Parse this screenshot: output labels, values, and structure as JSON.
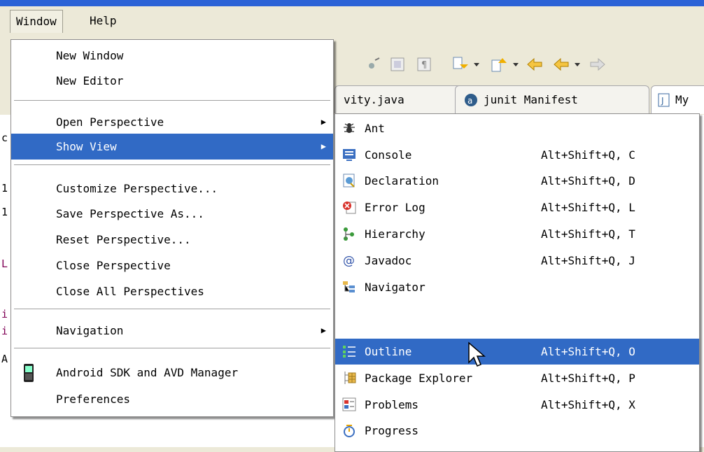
{
  "menubar": {
    "window": "Window",
    "help": "Help"
  },
  "tabs": [
    {
      "label": "vity.java"
    },
    {
      "label": "junit Manifest"
    },
    {
      "label": "My"
    }
  ],
  "window_menu": {
    "new_window": "New Window",
    "new_editor": "New Editor",
    "open_perspective": "Open Perspective",
    "show_view": "Show View",
    "customize_perspective": "Customize Perspective...",
    "save_perspective_as": "Save Perspective As...",
    "reset_perspective": "Reset Perspective...",
    "close_perspective": "Close Perspective",
    "close_all_perspectives": "Close All Perspectives",
    "navigation": "Navigation",
    "android_sdk": "Android SDK and AVD Manager",
    "preferences": "Preferences"
  },
  "show_view_menu": [
    {
      "label": "Ant",
      "shortcut": "",
      "icon": "ant-icon"
    },
    {
      "label": "Console",
      "shortcut": "Alt+Shift+Q, C",
      "icon": "console-icon"
    },
    {
      "label": "Declaration",
      "shortcut": "Alt+Shift+Q, D",
      "icon": "declaration-icon"
    },
    {
      "label": "Error Log",
      "shortcut": "Alt+Shift+Q, L",
      "icon": "error-log-icon"
    },
    {
      "label": "Hierarchy",
      "shortcut": "Alt+Shift+Q, T",
      "icon": "hierarchy-icon"
    },
    {
      "label": "Javadoc",
      "shortcut": "Alt+Shift+Q, J",
      "icon": "javadoc-icon"
    },
    {
      "label": "Navigator",
      "shortcut": "",
      "icon": "navigator-icon"
    },
    {
      "label": "Outline",
      "shortcut": "Alt+Shift+Q, O",
      "icon": "outline-icon"
    },
    {
      "label": "Package Explorer",
      "shortcut": "Alt+Shift+Q, P",
      "icon": "package-explorer-icon"
    },
    {
      "label": "Problems",
      "shortcut": "Alt+Shift+Q, X",
      "icon": "problems-icon"
    },
    {
      "label": "Progress",
      "shortcut": "",
      "icon": "progress-icon"
    }
  ],
  "editor_left_margin": [
    "c",
    "1",
    "1",
    "L",
    "i",
    "i",
    "A"
  ],
  "colors": {
    "selection": "#316ac5",
    "titlebar": "#2b62d6",
    "keyword": "#7f0055"
  }
}
